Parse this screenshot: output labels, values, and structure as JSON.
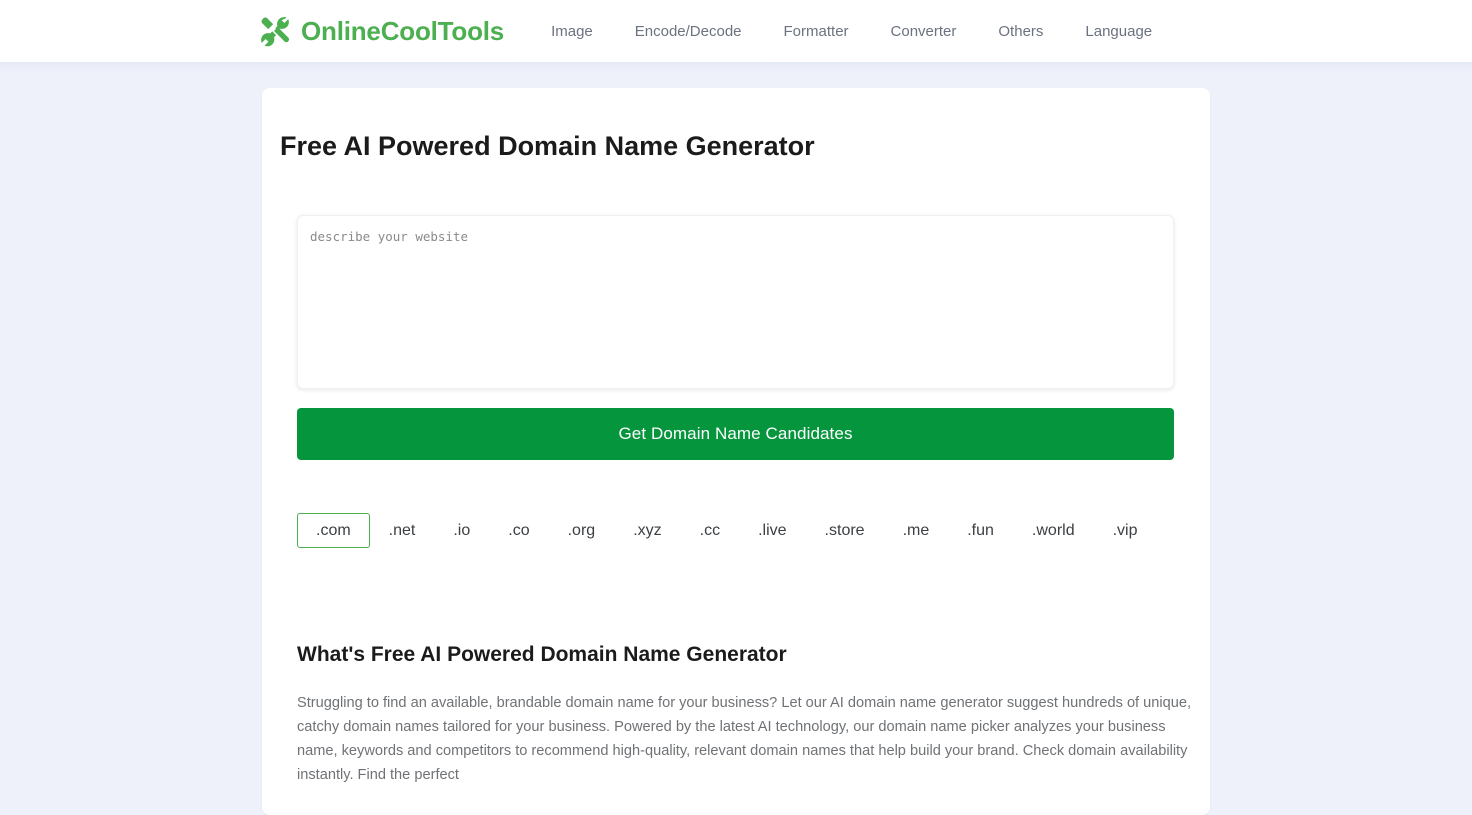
{
  "header": {
    "brand_name": "OnlineCoolTools",
    "brand_icon": "tools-icon",
    "brand_color": "#4caf50",
    "nav_items": [
      {
        "label": "Image",
        "name": "nav-item-image"
      },
      {
        "label": "Encode/Decode",
        "name": "nav-item-encode-decode"
      },
      {
        "label": "Formatter",
        "name": "nav-item-formatter"
      },
      {
        "label": "Converter",
        "name": "nav-item-converter"
      },
      {
        "label": "Others",
        "name": "nav-item-others"
      },
      {
        "label": "Language",
        "name": "nav-item-language"
      }
    ]
  },
  "tool": {
    "title": "Free AI Powered Domain Name Generator",
    "describe_placeholder": "describe your website",
    "describe_value": "",
    "submit_label": "Get Domain Name Candidates",
    "submit_color": "#05953c",
    "tlds": [
      {
        "label": ".com",
        "selected": true
      },
      {
        "label": ".net",
        "selected": false
      },
      {
        "label": ".io",
        "selected": false
      },
      {
        "label": ".co",
        "selected": false
      },
      {
        "label": ".org",
        "selected": false
      },
      {
        "label": ".xyz",
        "selected": false
      },
      {
        "label": ".cc",
        "selected": false
      },
      {
        "label": ".live",
        "selected": false
      },
      {
        "label": ".store",
        "selected": false
      },
      {
        "label": ".me",
        "selected": false
      },
      {
        "label": ".fun",
        "selected": false
      },
      {
        "label": ".world",
        "selected": false
      },
      {
        "label": ".vip",
        "selected": false
      }
    ],
    "selected_tld_border_color": "#4caf50"
  },
  "article": {
    "heading": "What's Free AI Powered Domain Name Generator",
    "body": "Struggling to find an available, brandable domain name for your business? Let our AI domain name generator suggest hundreds of unique, catchy domain names tailored for your business. Powered by the latest AI technology, our domain name picker analyzes your business name, keywords and competitors to recommend high-quality, relevant domain names that help build your brand. Check domain availability instantly. Find the perfect"
  }
}
